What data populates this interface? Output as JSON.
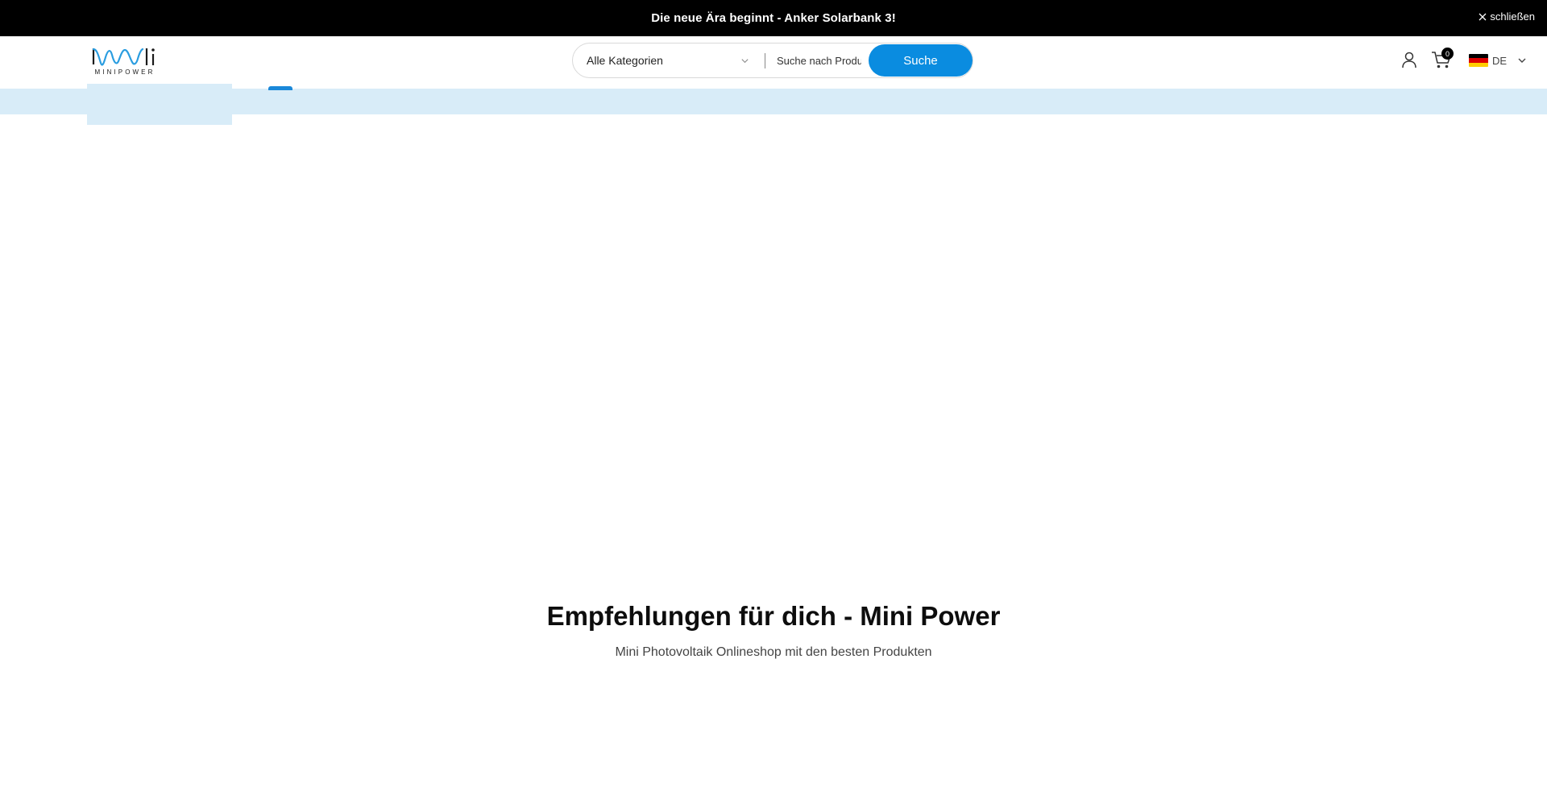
{
  "announcement": {
    "text": "Die neue Ära beginnt - Anker Solarbank 3!",
    "close_label": "schließen",
    "close_icon": "close-icon"
  },
  "header": {
    "logo_text": "MINIPOWER",
    "search": {
      "category": "Alle Kategorien",
      "placeholder": "Suche nach Produkten",
      "button_label": "Suche"
    },
    "cart_count": "0",
    "language": "DE",
    "icons": [
      "account-icon",
      "cart-icon",
      "flag-de-icon",
      "chevron-down-icon"
    ]
  },
  "colors": {
    "accent": "#0a8ce0",
    "nav_strip": "#d8ecf8",
    "announcement_bg": "#000000"
  },
  "section": {
    "title": "Empfehlungen für dich - Mini Power",
    "subtitle": "Mini Photovoltaik Onlineshop mit den besten Produkten"
  }
}
